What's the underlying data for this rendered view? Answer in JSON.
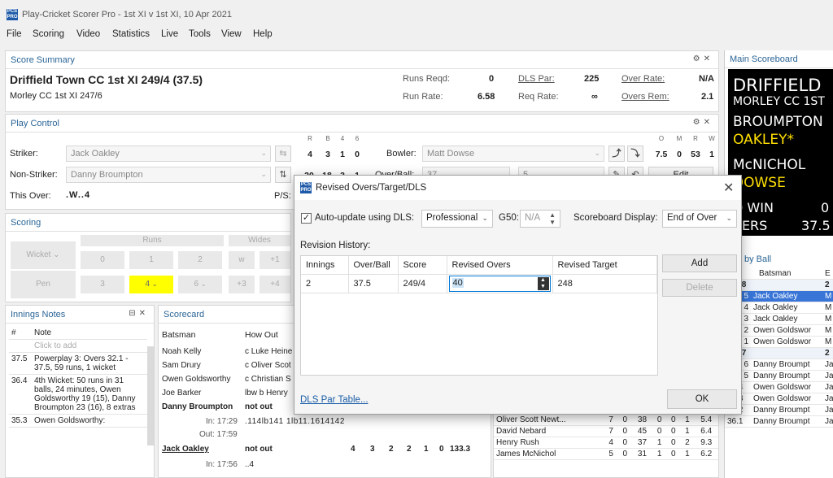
{
  "app": {
    "icon_text": "PCS PRO",
    "title": "Play-Cricket Scorer Pro - 1st XI v 1st XI, 10 Apr 2021"
  },
  "menu": [
    "File",
    "Scoring",
    "Video",
    "Statistics",
    "Live",
    "Tools",
    "View",
    "Help"
  ],
  "score_summary": {
    "header": "Score Summary",
    "batting_team_score": "Driffield Town CC 1st XI 249/4 (37.5)",
    "other_team_score": "Morley CC 1st XI 247/6",
    "runs_reqd_label": "Runs Reqd:",
    "runs_reqd": "0",
    "dls_par_label": "DLS Par:",
    "dls_par": "225",
    "over_rate_label": "Over Rate:",
    "over_rate": "N/A",
    "run_rate_label": "Run Rate:",
    "run_rate": "6.58",
    "req_rate_label": "Req Rate:",
    "req_rate": "∞",
    "overs_rem_label": "Overs Rem:",
    "overs_rem": "2.1"
  },
  "play_control": {
    "header": "Play Control",
    "striker_label": "Striker:",
    "striker": "Jack Oakley",
    "non_striker_label": "Non-Striker:",
    "non_striker": "Danny Broumpton",
    "this_over_label": "This Over:",
    "this_over": ".W..4",
    "ps_label": "P/S:",
    "stat_headers": [
      "R",
      "B",
      "4",
      "6"
    ],
    "striker_stats": [
      "4",
      "3",
      "1",
      "0"
    ],
    "non_striker_stats": [
      "20",
      "18",
      "3",
      "1"
    ],
    "bowler_label": "Bowler:",
    "bowler": "Matt Dowse",
    "bowler_headers": [
      "O",
      "M",
      "R",
      "W"
    ],
    "bowler_stats": [
      "7.5",
      "0",
      "53",
      "1"
    ],
    "over_ball_label": "Over/Ball:",
    "over_value": "37",
    "ball_value": "5",
    "edit_label": "Edit"
  },
  "scoring": {
    "header": "Scoring",
    "wicket": "Wicket",
    "runs": "Runs",
    "wides": "Wides",
    "pen": "Pen",
    "row1": [
      "0",
      "1",
      "2",
      "w",
      "+1"
    ],
    "row2": [
      "3",
      "4",
      "6",
      "+3",
      "+4"
    ]
  },
  "innings_notes": {
    "header": "Innings Notes",
    "col_num": "#",
    "col_note": "Note",
    "placeholder": "Click to add",
    "rows": [
      {
        "over": "37.5",
        "note": "Powerplay 3: Overs 32.1 - 37.5, 59 runs, 1 wicket"
      },
      {
        "over": "36.4",
        "note": "4th Wicket: 50 runs in 31 balls, 24 minutes, Owen Goldsworthy 19 (15), Danny Broumpton 23 (16), 8 extras"
      },
      {
        "over": "35.3",
        "note": "Owen Goldsworthy:"
      }
    ]
  },
  "scorecard": {
    "header": "Scorecard",
    "col_batsman": "Batsman",
    "col_how_out": "How Out",
    "rows": [
      {
        "batsman": "Noah Kelly",
        "how_out": "c Luke Heine"
      },
      {
        "batsman": "Sam Drury",
        "how_out": "c Oliver Scot"
      },
      {
        "batsman": "Owen Goldsworthy",
        "how_out": "c Christian S"
      },
      {
        "batsman": "Joe Barker",
        "how_out": "lbw b Henry"
      },
      {
        "batsman": "Danny Broumpton",
        "how_out": "not out"
      }
    ],
    "broumpton_in": "In: 17:29",
    "broumpton_out": "Out: 17:59",
    "broumpton_balls": ".114lb141 1lb11.1614142",
    "oakley": {
      "batsman": "Jack Oakley",
      "how_out": "not out",
      "r": "4",
      "b": "3",
      "m": "2",
      "fours": "2",
      "sixes": "1",
      "zero": "0",
      "sr": "133.3"
    },
    "oakley_in": "In: 17:56",
    "oakley_balls": "..4"
  },
  "bowling": {
    "rows": [
      [
        "Oliver Scott Newt...",
        "7",
        "0",
        "38",
        "0",
        "0",
        "1",
        "5.4"
      ],
      [
        "David Nebard",
        "7",
        "0",
        "45",
        "0",
        "0",
        "1",
        "6.4"
      ],
      [
        "Henry Rush",
        "4",
        "0",
        "37",
        "1",
        "0",
        "2",
        "9.3"
      ],
      [
        "James McNichol",
        "5",
        "0",
        "31",
        "1",
        "0",
        "1",
        "6.2"
      ]
    ]
  },
  "main_scoreboard": {
    "header": "Main Scoreboard",
    "lines": [
      "DRIFFIELD",
      "MORLEY CC 1ST",
      "BROUMPTON",
      "OAKLEY*",
      "McNICHOL",
      "DOWSE",
      "D WIN",
      "VERS"
    ],
    "right_vals": [
      "0",
      "37.5"
    ]
  },
  "ball_by_ball": {
    "header": "by Ball",
    "col_batsman": "Batsman",
    "over_38": "er 38",
    "over_37": "er 37",
    "over_38_num": "2",
    "over_37_num": "2",
    "rows_38": [
      {
        "b": "5",
        "name": "Jack Oakley",
        "x": "M"
      },
      {
        "b": "4",
        "name": "Jack Oakley",
        "x": "M"
      },
      {
        "b": "3",
        "name": "Jack Oakley",
        "x": "M"
      },
      {
        "b": "2",
        "name": "Owen Goldswor",
        "x": "M"
      },
      {
        "b": "1",
        "name": "Owen Goldswor",
        "x": "M"
      }
    ],
    "rows_37": [
      {
        "b": "6",
        "name": "Danny Broumpt",
        "x": "Ja"
      },
      {
        "b": "5",
        "name": "Danny Broumpt",
        "x": "Ja"
      },
      {
        "b": "36.4",
        "name": "Owen Goldswor",
        "x": "Ja"
      },
      {
        "b": "36.3",
        "name": "Owen Goldswor",
        "x": "Ja"
      },
      {
        "b": "36.2",
        "name": "Danny Broumpt",
        "x": "Ja"
      },
      {
        "b": "36.1",
        "name": "Danny Broumpt",
        "x": "Ja"
      }
    ]
  },
  "dialog": {
    "title": "Revised Overs/Target/DLS",
    "auto_update_label": "Auto-update using DLS:",
    "dls_mode": "Professional",
    "g50_label": "G50:",
    "g50_value": "N/A",
    "scoreboard_display_label": "Scoreboard Display:",
    "scoreboard_display": "End of Over",
    "revision_history_label": "Revision History:",
    "columns": [
      "Innings",
      "Over/Ball",
      "Score",
      "Revised Overs",
      "Revised Target"
    ],
    "row": {
      "innings": "2",
      "over_ball": "37.5",
      "score": "249/4",
      "revised_overs": "40",
      "revised_target": "248"
    },
    "add_label": "Add",
    "delete_label": "Delete",
    "dls_par_table_link": "DLS Par Table...",
    "ok_label": "OK",
    "colors": {
      "selected_row": "#cce4f7",
      "highlight_four": "#ffff00",
      "scoreboard_yellow": "#ffe000"
    }
  }
}
